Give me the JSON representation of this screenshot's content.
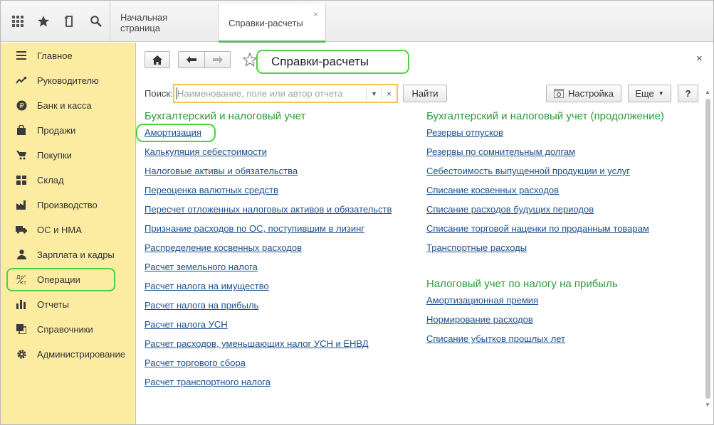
{
  "topbar": {
    "icons": [
      "apps-grid-icon",
      "star-icon",
      "history-icon",
      "search-icon"
    ],
    "tabs": [
      {
        "label": "Начальная страница"
      },
      {
        "label": "Справки-расчеты",
        "close": "×"
      }
    ]
  },
  "sidebar": {
    "items": [
      {
        "label": "Главное",
        "icon": "menu-lines-icon"
      },
      {
        "label": "Руководителю",
        "icon": "trend-chart-icon"
      },
      {
        "label": "Банк и касса",
        "icon": "ruble-coin-icon"
      },
      {
        "label": "Продажи",
        "icon": "shopping-bag-icon"
      },
      {
        "label": "Покупки",
        "icon": "shopping-cart-icon"
      },
      {
        "label": "Склад",
        "icon": "warehouse-grid-icon"
      },
      {
        "label": "Производство",
        "icon": "factory-icon"
      },
      {
        "label": "ОС и НМА",
        "icon": "truck-icon"
      },
      {
        "label": "Зарплата и кадры",
        "icon": "person-icon"
      },
      {
        "label": "Операции",
        "icon": "debit-credit-icon",
        "icon_text": "Дт\nКт"
      },
      {
        "label": "Отчеты",
        "icon": "bar-chart-icon"
      },
      {
        "label": "Справочники",
        "icon": "books-icon"
      },
      {
        "label": "Администрирование",
        "icon": "gear-icon"
      }
    ],
    "highlighted": "Операции"
  },
  "header": {
    "title": "Справки-расчеты",
    "close": "×"
  },
  "search": {
    "label": "Поиск:",
    "placeholder": "Наименование, поле или автор отчета",
    "value": "",
    "find_button": "Найти"
  },
  "toolbar": {
    "settings_button": "Настройка",
    "more_button": "Еще",
    "help_button": "?"
  },
  "groups": {
    "left": {
      "title": "Бухгалтерский и налоговый учет",
      "links": [
        "Амортизация",
        "Калькуляция себестоимости",
        "Налоговые активы и обязательства",
        "Переоценка валютных средств",
        "Пересчет отложенных налоговых активов и обязательств",
        "Признание расходов по ОС, поступившим в лизинг",
        "Распределение косвенных расходов",
        "Расчет земельного налога",
        "Расчет налога на имущество",
        "Расчет налога на прибыль",
        "Расчет налога УСН",
        "Расчет расходов, уменьшающих налог УСН и ЕНВД",
        "Расчет торгового сбора",
        "Расчет транспортного налога"
      ]
    },
    "right1": {
      "title": "Бухгалтерский и налоговый учет (продолжение)",
      "links": [
        "Резервы отпусков",
        "Резервы по сомнительным долгам",
        "Себестоимость выпущенной продукции и услуг",
        "Списание косвенных расходов",
        "Списание расходов будущих периодов",
        "Списание торговой наценки по проданным товарам",
        "Транспортные расходы"
      ]
    },
    "right2": {
      "title": "Налоговый учет по налогу на прибыль",
      "links": [
        "Амортизационная премия",
        "Нормирование расходов",
        "Списание убытков прошлых лет"
      ]
    }
  },
  "highlight_color": "#4cd23c",
  "group_title_color": "#2e9a3a",
  "link_color": "#1c4f8e",
  "sidebar_color": "#fbeca2"
}
